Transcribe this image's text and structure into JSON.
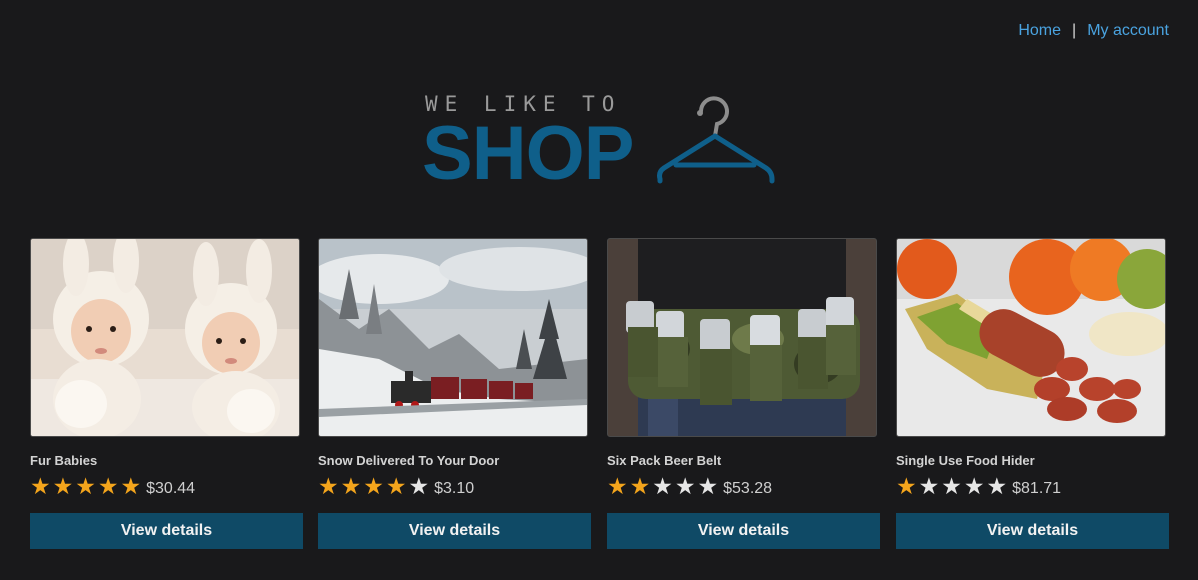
{
  "nav": {
    "home": "Home",
    "separator": "|",
    "account": "My account"
  },
  "logo": {
    "tagline": "WE LIKE TO",
    "wordmark": "SHOP"
  },
  "products": [
    {
      "title": "Fur Babies",
      "rating": 5,
      "price": "$30.44",
      "button": "View details",
      "image": "two babies in bunny hats"
    },
    {
      "title": "Snow Delivered To Your Door",
      "rating": 4,
      "price": "$3.10",
      "button": "View details",
      "image": "steam train in snowy forest"
    },
    {
      "title": "Six Pack Beer Belt",
      "rating": 2,
      "price": "$53.28",
      "button": "View details",
      "image": "camouflage beer can belt"
    },
    {
      "title": "Single Use Food Hider",
      "rating": 1,
      "price": "$81.71",
      "button": "View details",
      "image": "sausage hidden in banana peel"
    }
  ],
  "colors": {
    "background": "#19191b",
    "link": "#4aa3e0",
    "brand": "#0f5f8a",
    "button": "#0f4a66",
    "star_on": "#f4a51c",
    "star_off": "#e6e6e6"
  },
  "icons": {
    "star": "star-icon",
    "hanger": "hanger-icon"
  }
}
